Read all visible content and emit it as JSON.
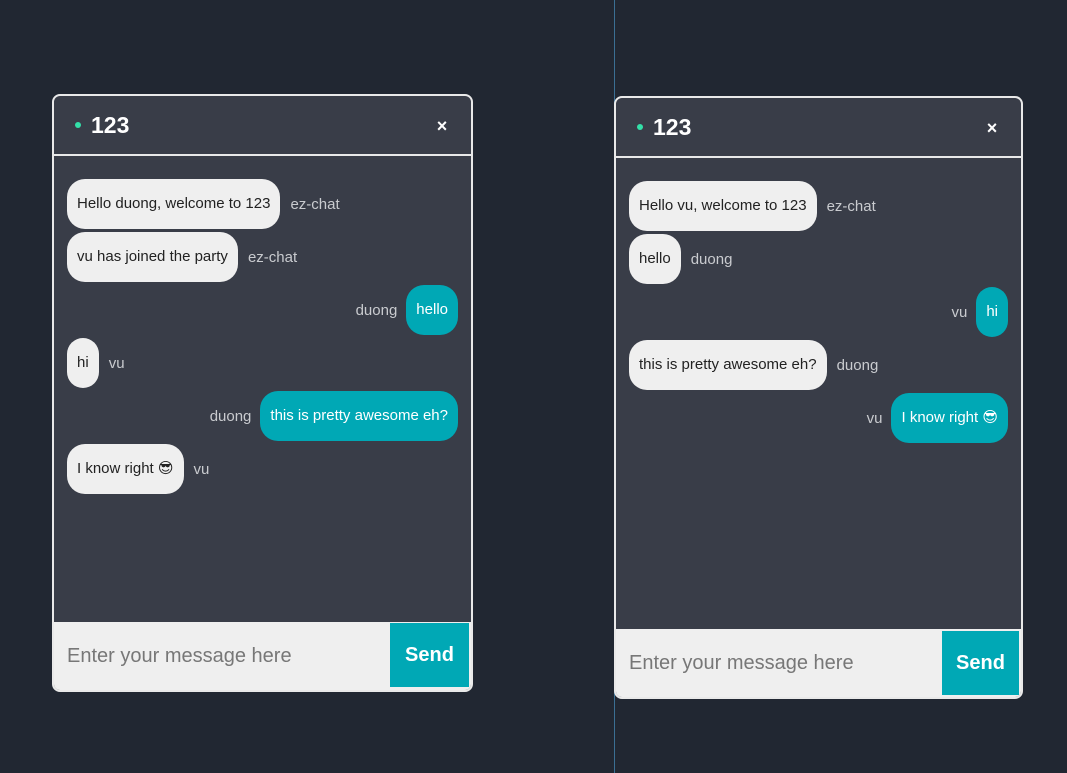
{
  "windows": [
    {
      "room": "123",
      "close_label": "×",
      "messages": [
        {
          "text": "Hello duong, welcome to 123",
          "sender": "ez-chat",
          "direction": "incoming"
        },
        {
          "text": "vu has joined the party",
          "sender": "ez-chat",
          "direction": "incoming"
        },
        {
          "text": "hello",
          "sender": "duong",
          "direction": "outgoing"
        },
        {
          "text": "hi",
          "sender": "vu",
          "direction": "incoming"
        },
        {
          "text": "this is pretty awesome eh?",
          "sender": "duong",
          "direction": "outgoing"
        },
        {
          "text": "I know right 😎",
          "sender": "vu",
          "direction": "incoming"
        }
      ],
      "input_placeholder": "Enter your message here",
      "send_label": "Send"
    },
    {
      "room": "123",
      "close_label": "×",
      "messages": [
        {
          "text": "Hello vu, welcome to 123",
          "sender": "ez-chat",
          "direction": "incoming"
        },
        {
          "text": "hello",
          "sender": "duong",
          "direction": "incoming"
        },
        {
          "text": "hi",
          "sender": "vu",
          "direction": "outgoing"
        },
        {
          "text": "this is pretty awesome eh?",
          "sender": "duong",
          "direction": "incoming"
        },
        {
          "text": "I know right 😎",
          "sender": "vu",
          "direction": "outgoing"
        }
      ],
      "input_placeholder": "Enter your message here",
      "send_label": "Send"
    }
  ],
  "colors": {
    "background": "#212732",
    "panel": "#393d48",
    "accent": "#00a8b5",
    "online_dot": "#33e0a8",
    "incoming_bubble": "#efefef"
  },
  "icons": {
    "status": "online-status-dot",
    "close": "close-icon"
  }
}
